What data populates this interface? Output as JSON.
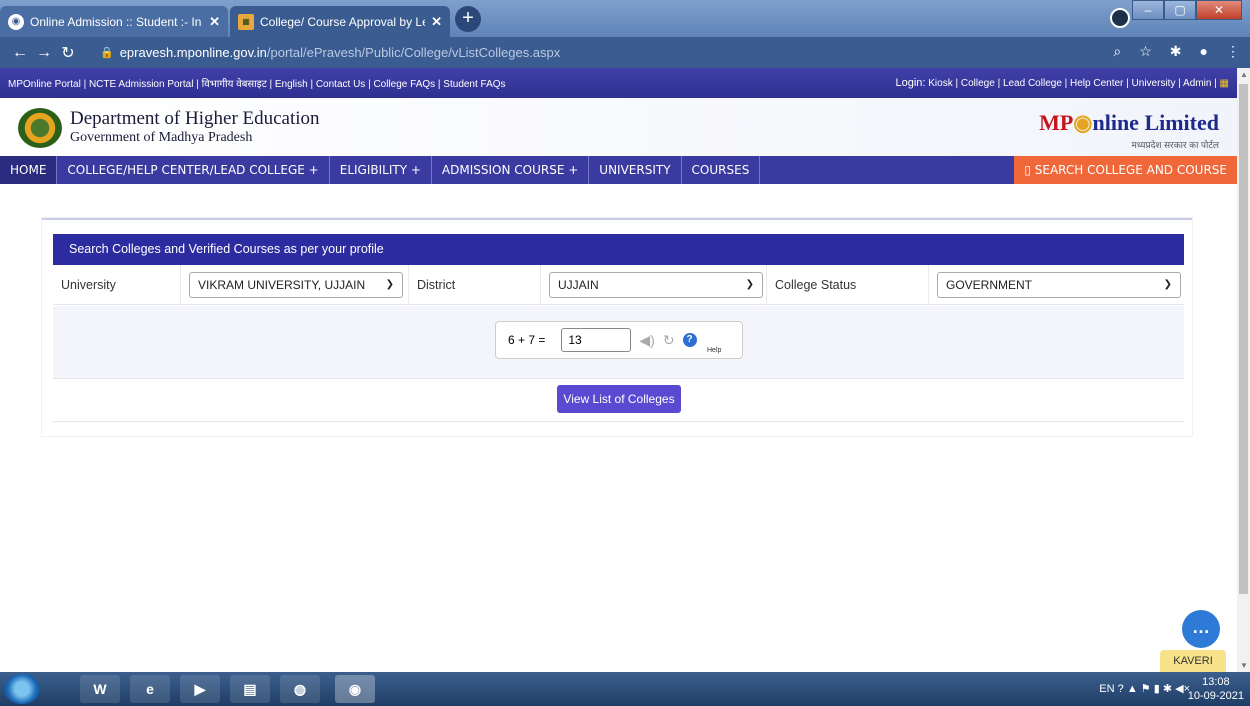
{
  "browser": {
    "tabs": [
      {
        "title": "Online Admission :: Student :- In",
        "active": false
      },
      {
        "title": "College/ Course Approval by Lea",
        "active": true
      }
    ],
    "url_host": "epravesh.mponline.gov.in",
    "url_path": "/portal/ePravesh/Public/College/vListColleges.aspx"
  },
  "toplinks": {
    "left": "MPOnline Portal | NCTE Admission Portal | विभागीय वेबसाइट | English | Contact Us | College FAQs | Student FAQs",
    "login_label": "Login:",
    "right": "Kiosk | College | Lead College | Help Center | University | Admin |"
  },
  "header": {
    "dept": "Department of Higher Education",
    "govt": "Government of Madhya Pradesh",
    "brand_mp": "MP",
    "brand_rest": "nline Limited",
    "brand_sub": "मध्यप्रदेश सरकार का पोर्टल"
  },
  "nav": {
    "home": "HOME",
    "college": "COLLEGE/HELP CENTER/LEAD COLLEGE +",
    "eligibility": "ELIGIBILITY +",
    "admission": "ADMISSION COURSE +",
    "university": "UNIVERSITY",
    "courses": "COURSES",
    "search": "▯ SEARCH COLLEGE AND COURSE"
  },
  "panel": {
    "heading": "Search Colleges and Verified Courses as per your profile",
    "university_label": "University",
    "university_value": "VIKRAM UNIVERSITY, UJJAIN",
    "district_label": "District",
    "district_value": "UJJAIN",
    "status_label": "College Status",
    "status_value": "GOVERNMENT",
    "captcha_question": "6 + 7 =",
    "captcha_answer": "13",
    "help_label": "Help",
    "view_button": "View List of Colleges"
  },
  "chat": {
    "label": "KAVERI"
  },
  "taskbar": {
    "lang": "EN",
    "time": "13:08",
    "date": "10-09-2021"
  }
}
